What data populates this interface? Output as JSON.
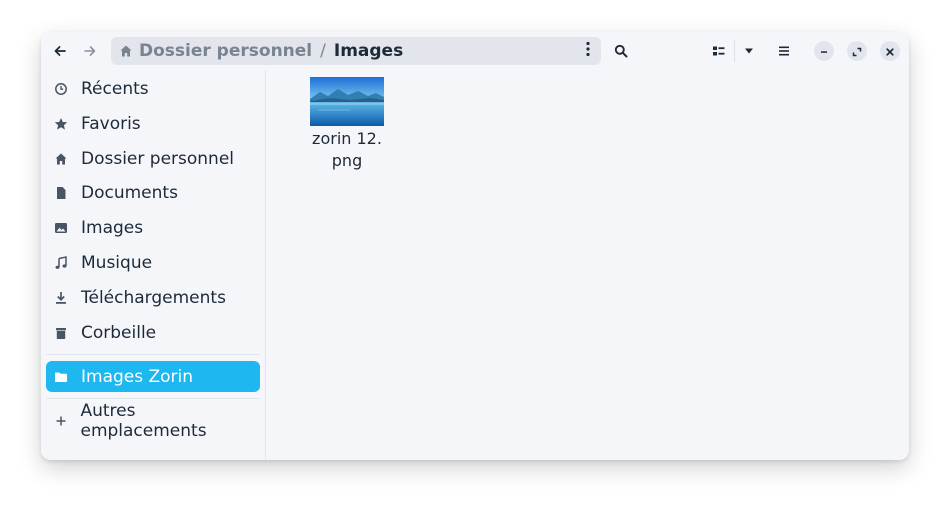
{
  "headerbar": {
    "back_icon": "arrow-left-icon",
    "forward_icon": "arrow-right-icon",
    "path": {
      "home_icon": "home-icon",
      "home_label": "Dossier personnel",
      "separator": "/",
      "current": "Images"
    },
    "path_menu_icon": "vertical-dots-icon",
    "search_icon": "search-icon",
    "view_icon": "list-view-icon",
    "view_dropdown_icon": "chevron-down-icon",
    "menu_icon": "hamburger-menu-icon",
    "minimize_icon": "minimize-icon",
    "maximize_icon": "maximize-icon",
    "close_icon": "close-icon"
  },
  "sidebar": {
    "items": [
      {
        "label": "Récents",
        "icon": "clock-icon"
      },
      {
        "label": "Favoris",
        "icon": "star-icon"
      },
      {
        "label": "Dossier personnel",
        "icon": "home-icon"
      },
      {
        "label": "Documents",
        "icon": "document-icon"
      },
      {
        "label": "Images",
        "icon": "image-icon"
      },
      {
        "label": "Musique",
        "icon": "music-icon"
      },
      {
        "label": "Téléchargements",
        "icon": "download-icon"
      },
      {
        "label": "Corbeille",
        "icon": "trash-icon"
      }
    ],
    "bookmark": {
      "label": "Images Zorin",
      "icon": "folder-icon",
      "active": true
    },
    "other_locations": {
      "label": "Autres emplacements",
      "icon": "plus-icon"
    },
    "accent_color": "#1eb7f0"
  },
  "content": {
    "files": [
      {
        "name": "zorin 12.\npng",
        "thumbnail": "lake-mountains-image"
      }
    ]
  }
}
